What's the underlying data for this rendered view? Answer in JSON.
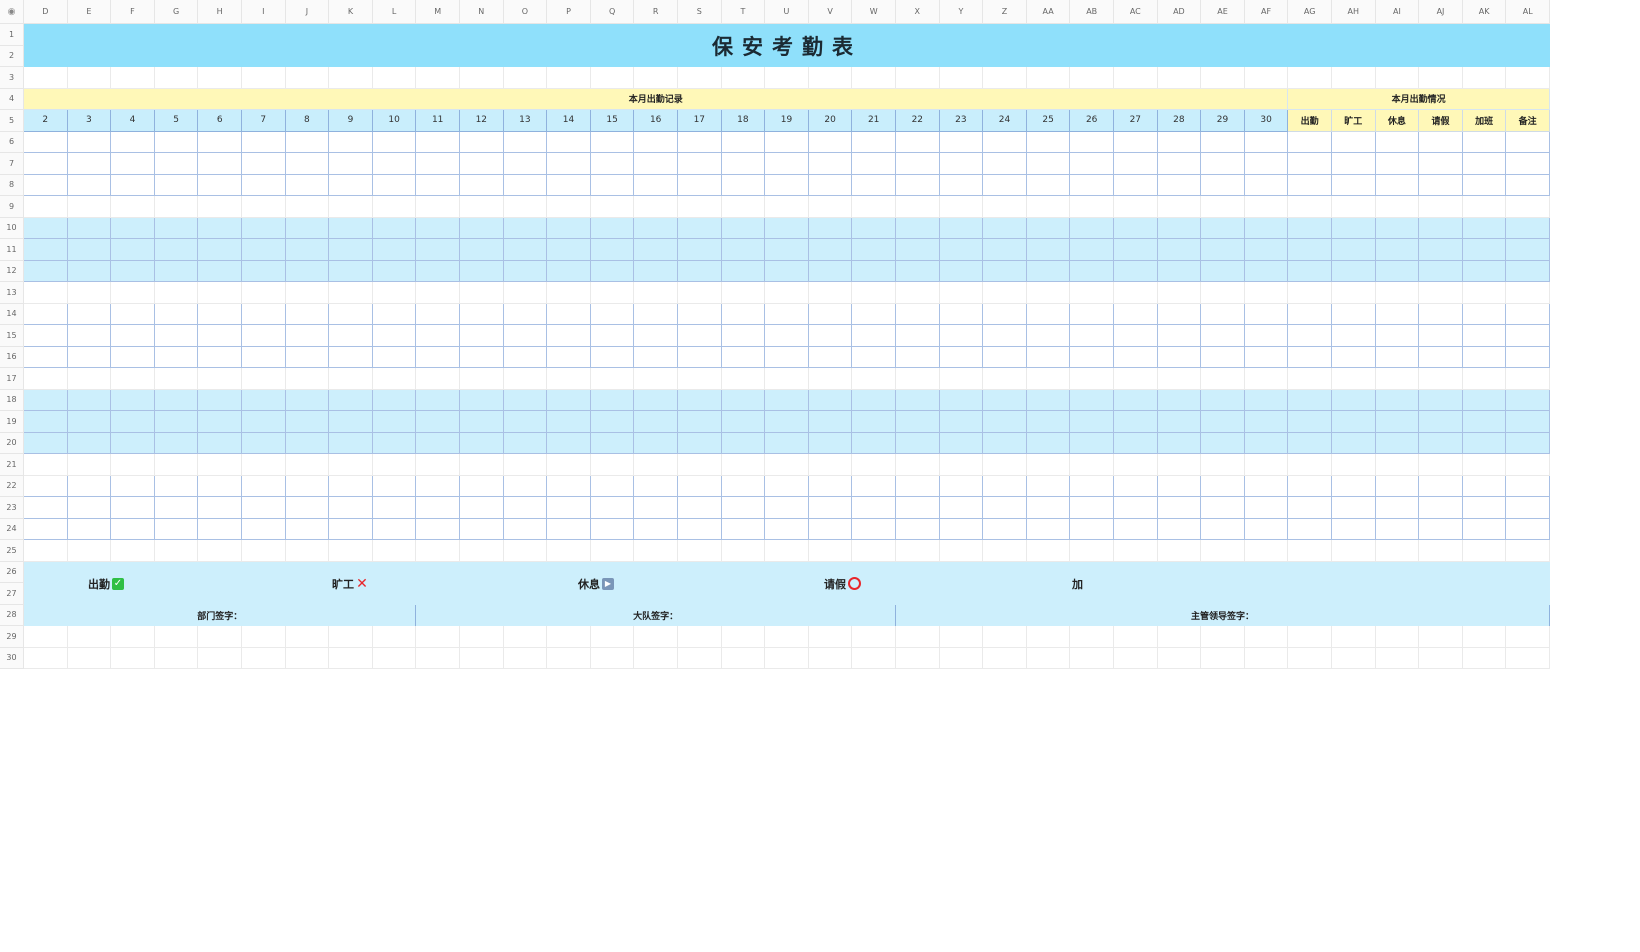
{
  "column_headers": [
    "D",
    "E",
    "F",
    "G",
    "H",
    "I",
    "J",
    "K",
    "L",
    "M",
    "N",
    "O",
    "P",
    "Q",
    "R",
    "S",
    "T",
    "U",
    "V",
    "W",
    "X",
    "Y",
    "Z",
    "AA",
    "AB",
    "AC",
    "AD",
    "AE",
    "AF",
    "AG",
    "AH",
    "AI",
    "AJ",
    "AK",
    "AL"
  ],
  "row_headers": [
    "1",
    "2",
    "3",
    "4",
    "5",
    "6",
    "7",
    "8",
    "9",
    "10",
    "11",
    "12",
    "13",
    "14",
    "15",
    "16",
    "17",
    "18",
    "19",
    "20",
    "21",
    "22",
    "23",
    "24",
    "25",
    "26",
    "27",
    "28",
    "29",
    "30"
  ],
  "title": "保安考勤表",
  "monthly_record_label": "本月出勤记录",
  "monthly_summary_label": "本月出勤情况",
  "days": [
    "2",
    "3",
    "4",
    "5",
    "6",
    "7",
    "8",
    "9",
    "10",
    "11",
    "12",
    "13",
    "14",
    "15",
    "16",
    "17",
    "18",
    "19",
    "20",
    "21",
    "22",
    "23",
    "24",
    "25",
    "26",
    "27",
    "28",
    "29",
    "30"
  ],
  "summary_columns": [
    "出勤",
    "旷工",
    "休息",
    "请假",
    "加班",
    "备注"
  ],
  "legend": [
    {
      "label": "出勤",
      "icon": "check-icon",
      "color": "#2fbf45"
    },
    {
      "label": "旷工",
      "icon": "cross-icon",
      "color": "#e8262b"
    },
    {
      "label": "休息",
      "icon": "play-icon",
      "color": "#7a96b8"
    },
    {
      "label": "请假",
      "icon": "circle-icon",
      "color": "#e8262b"
    },
    {
      "label": "加",
      "icon": "",
      "color": ""
    }
  ],
  "signatures": [
    "部门签字：",
    "大队签字：",
    "主管领导签字："
  ],
  "colors": {
    "title_bg": "#8fe0fb",
    "header_yellow": "#fff8b8",
    "band_blue": "#cdeffc",
    "grid_line": "#8fb2dd"
  }
}
